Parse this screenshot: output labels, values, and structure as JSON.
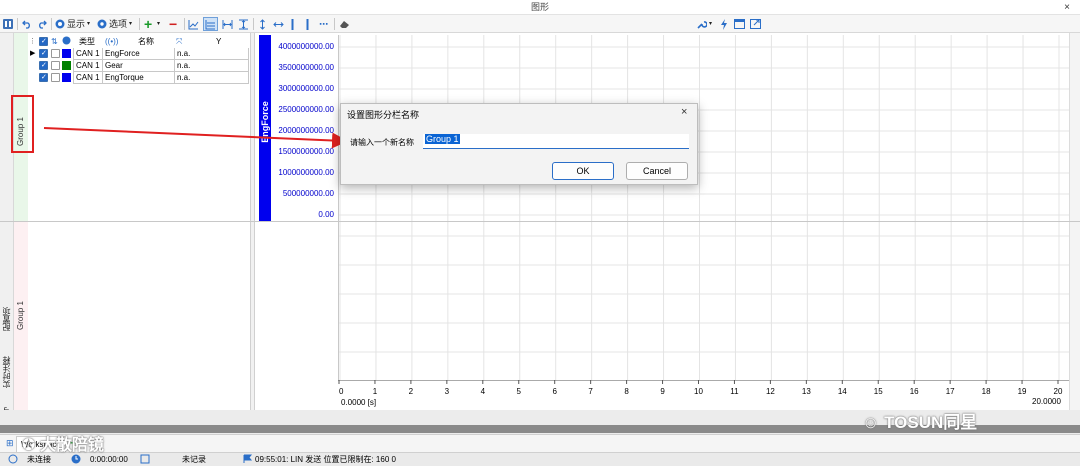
{
  "window": {
    "title": "图形",
    "close": "×"
  },
  "toolbar": {
    "display_label": "显示",
    "options_label": "选项",
    "add": "+",
    "remove": "−",
    "more": "⋯"
  },
  "signals": {
    "headers": {
      "type": "类型",
      "name": "名称",
      "y": "Y"
    },
    "rows": [
      {
        "type": "CAN 1",
        "name": "EngForce",
        "y": "n.a.",
        "color": "#0000ee"
      },
      {
        "type": "CAN 1",
        "name": "Gear",
        "y": "n.a.",
        "color": "#008000"
      },
      {
        "type": "CAN 1",
        "name": "EngTorque",
        "y": "n.a.",
        "color": "#0000ee"
      }
    ]
  },
  "groups": {
    "group1": "Group 1",
    "group2": "Group 1"
  },
  "sidetabs": {
    "config": "配置项",
    "notes": "实时注释",
    "signals": "信号"
  },
  "chart_data": {
    "type": "line",
    "ylabel": "EngForce",
    "y_ticks": [
      "4000000000.00",
      "3500000000.00",
      "3000000000.00",
      "2500000000.00",
      "2000000000.00",
      "1500000000.00",
      "1000000000.00",
      "500000000.00",
      "0.00"
    ],
    "ylim": [
      0,
      4000000000
    ],
    "x_ticks": [
      "0",
      "1",
      "2",
      "3",
      "4",
      "5",
      "6",
      "7",
      "8",
      "9",
      "10",
      "11",
      "12",
      "13",
      "14",
      "15",
      "16",
      "17",
      "18",
      "19",
      "20"
    ],
    "xlim": [
      0,
      20
    ],
    "x_start": "0.0000 [s]",
    "x_end": "20.0000",
    "series": [],
    "grid": true
  },
  "dialog": {
    "title": "设置图形分栏名称",
    "label": "请输入一个新名称",
    "value": "Group 1",
    "ok": "OK",
    "cancel": "Cancel",
    "close": "×"
  },
  "workspace": {
    "tab": "Workspace"
  },
  "status": {
    "conn": "未连接",
    "time": "0:00:00:00",
    "record": "未记录",
    "message": "09:55:01: LIN 发送 位置已限制在: 160 0"
  },
  "watermark": {
    "right": "TOSUN同星",
    "left": "大散陪镜"
  },
  "colors": {
    "axis": "#0000ee",
    "accent": "#2a6ec8",
    "annotation": "#e02020"
  }
}
